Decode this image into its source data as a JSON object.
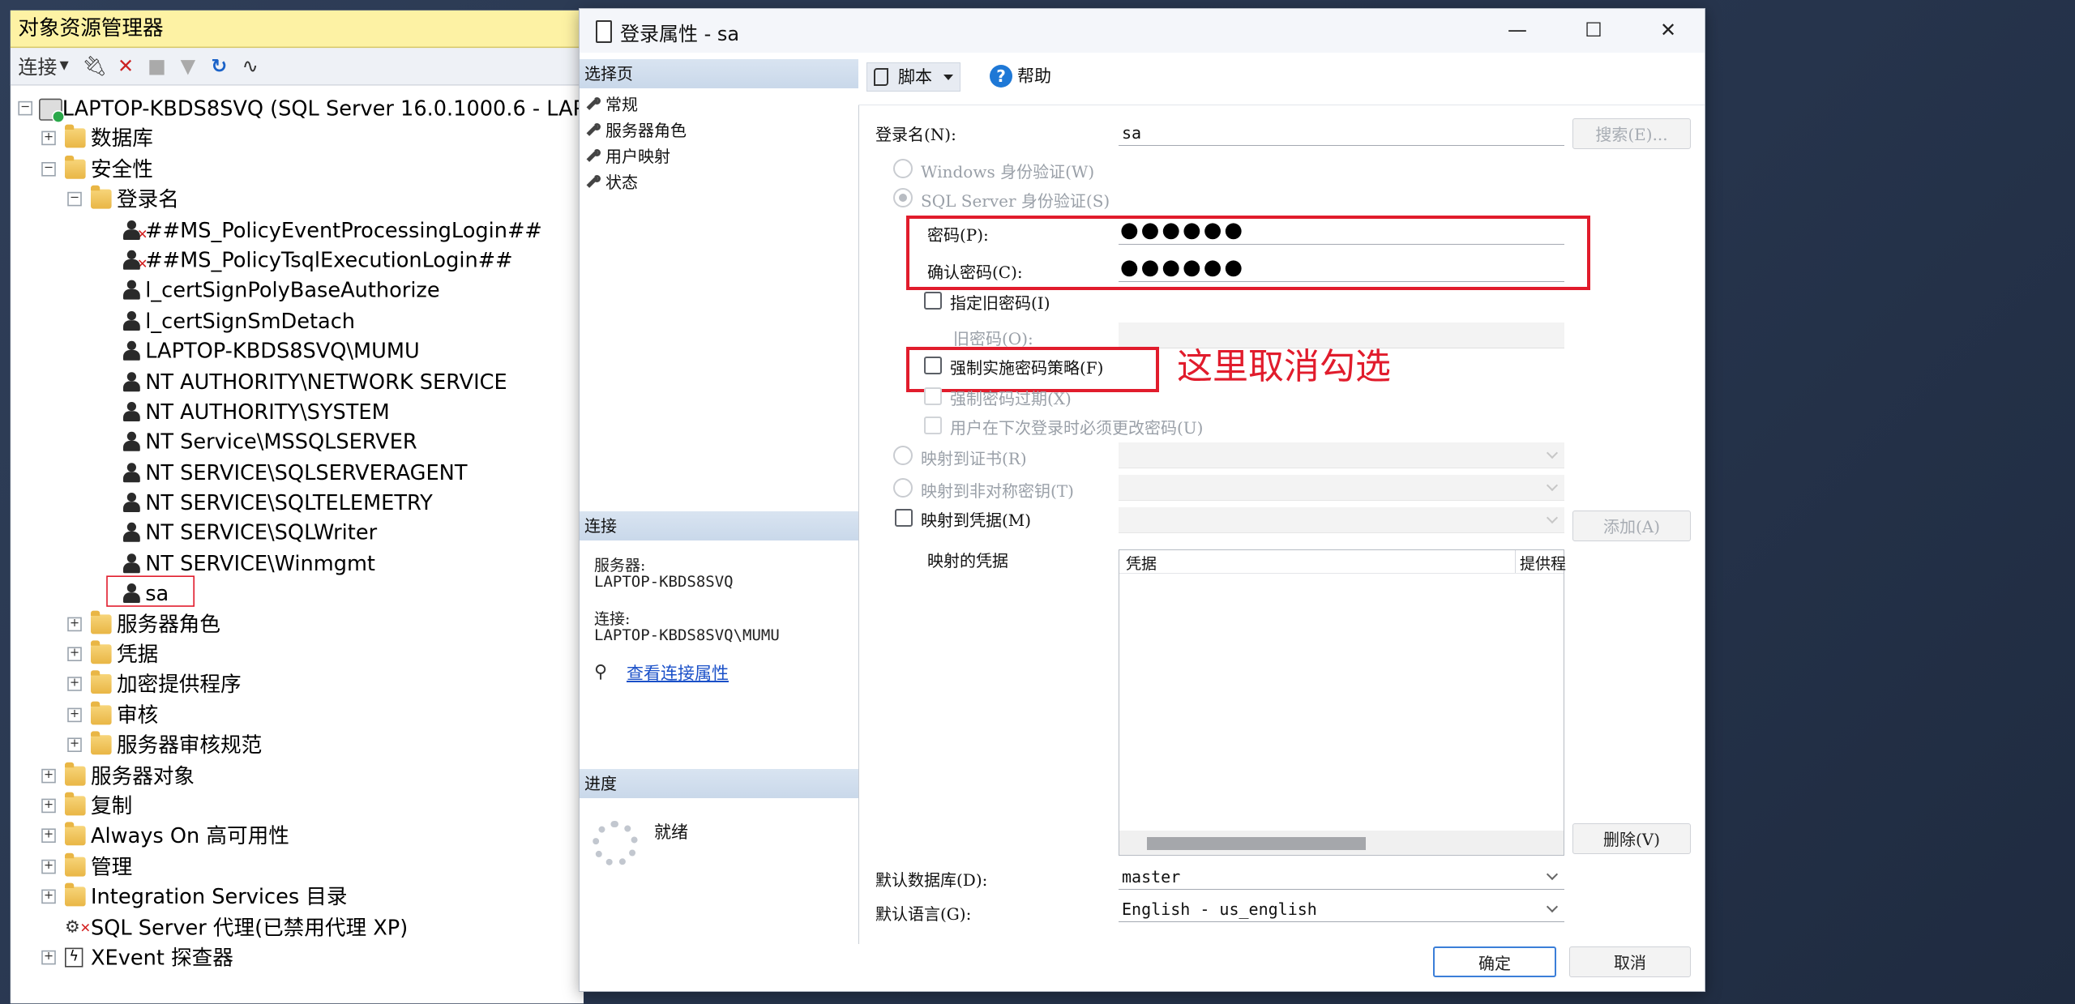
{
  "explorer": {
    "title": "对象资源管理器",
    "toolbar": {
      "connect": "连接"
    },
    "root": "LAPTOP-KBDS8SVQ (SQL Server 16.0.1000.6 - LAP",
    "nodes": {
      "databases": "数据库",
      "security": "安全性",
      "logins": "登录名",
      "server_roles": "服务器角色",
      "credentials": "凭据",
      "crypto": "加密提供程序",
      "audits": "审核",
      "audit_specs": "服务器审核规范",
      "server_objects": "服务器对象",
      "replication": "复制",
      "always_on": "Always On 高可用性",
      "management": "管理",
      "integration": "Integration Services 目录",
      "agent": "SQL Server 代理(已禁用代理 XP)",
      "xevent": "XEvent 探查器"
    },
    "logins": [
      "##MS_PolicyEventProcessingLogin##",
      "##MS_PolicyTsqlExecutionLogin##",
      "l_certSignPolyBaseAuthorize",
      "l_certSignSmDetach",
      "LAPTOP-KBDS8SVQ\\MUMU",
      "NT AUTHORITY\\NETWORK SERVICE",
      "NT AUTHORITY\\SYSTEM",
      "NT Service\\MSSQLSERVER",
      "NT SERVICE\\SQLSERVERAGENT",
      "NT SERVICE\\SQLTELEMETRY",
      "NT SERVICE\\SQLWriter",
      "NT SERVICE\\Winmgmt",
      "sa"
    ]
  },
  "dialog": {
    "title": "登录属性 - sa",
    "select_page": "选择页",
    "pages": [
      "常规",
      "服务器角色",
      "用户映射",
      "状态"
    ],
    "connection_header": "连接",
    "server_label": "服务器:",
    "server_value": "LAPTOP-KBDS8SVQ",
    "connection_label": "连接:",
    "connection_value": "LAPTOP-KBDS8SVQ\\MUMU",
    "view_conn_props": "查看连接属性",
    "progress_header": "进度",
    "progress_status": "就绪",
    "toolbar": {
      "script": "脚本",
      "help": "帮助"
    },
    "form": {
      "login_name_label": "登录名(N):",
      "login_name_value": "sa",
      "search_btn": "搜索(E)...",
      "windows_auth": "Windows 身份验证(W)",
      "sql_auth": "SQL Server 身份验证(S)",
      "password_label": "密码(P):",
      "password_value": "●●●●●●",
      "confirm_label": "确认密码(C):",
      "confirm_value": "●●●●●●",
      "specify_old": "指定旧密码(I)",
      "old_password_label": "旧密码(O):",
      "enforce_policy": "强制实施密码策略(F)",
      "enforce_expiration": "强制密码过期(X)",
      "must_change": "用户在下次登录时必须更改密码(U)",
      "map_cert": "映射到证书(R)",
      "map_asym": "映射到非对称密钥(T)",
      "map_cred": "映射到凭据(M)",
      "add_btn": "添加(A)",
      "mapped_creds": "映射的凭据",
      "col_credential": "凭据",
      "col_provider": "提供程",
      "remove_btn": "删除(V)",
      "default_db_label": "默认数据库(D):",
      "default_db_value": "master",
      "default_lang_label": "默认语言(G):",
      "default_lang_value": "English - us_english"
    },
    "ok_btn": "确定",
    "cancel_btn": "取消"
  },
  "annotation": "这里取消勾选",
  "colors": {
    "annotation": "#e11c2c",
    "explorer_title": "#fdf2a4",
    "link": "#1a50c8"
  }
}
